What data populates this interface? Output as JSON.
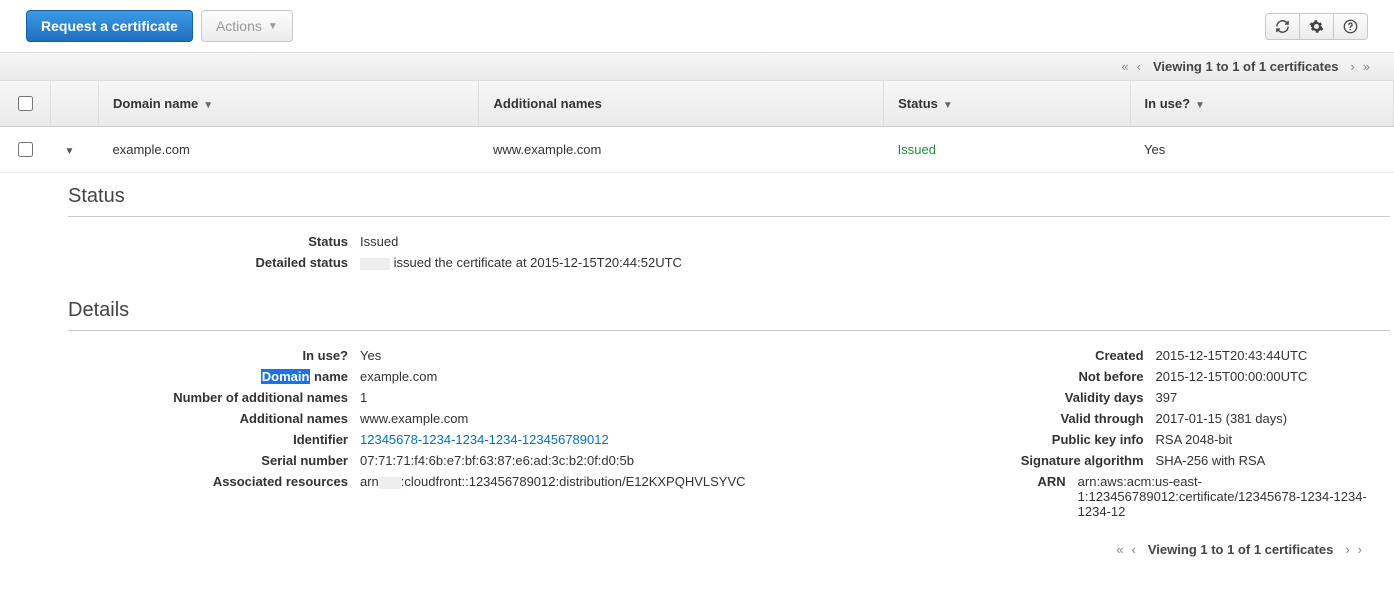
{
  "toolbar": {
    "request_label": "Request a certificate",
    "actions_label": "Actions"
  },
  "pager": {
    "text": "Viewing 1 to 1 of 1 certificates"
  },
  "table": {
    "headers": {
      "domain": "Domain name",
      "additional": "Additional names",
      "status": "Status",
      "inuse": "In use?"
    },
    "row": {
      "domain": "example.com",
      "additional": "www.example.com",
      "status": "Issued",
      "inuse": "Yes"
    }
  },
  "sections": {
    "status_title": "Status",
    "details_title": "Details"
  },
  "status": {
    "labels": {
      "status": "Status",
      "detailed": "Detailed status"
    },
    "status_value": "Issued",
    "detailed_pre": "",
    "detailed_value": " issued the certificate at 2015-12-15T20:44:52UTC"
  },
  "details": {
    "left_labels": {
      "in_use": "In use?",
      "domain_name_hi": "Domain",
      "domain_name_rest": " name",
      "num_additional": "Number of additional names",
      "additional_names": "Additional names",
      "identifier": "Identifier",
      "serial": "Serial number",
      "assoc": "Associated resources"
    },
    "left_values": {
      "in_use": "Yes",
      "domain_name": "example.com",
      "num_additional": "1",
      "additional_names": "www.example.com",
      "identifier": "12345678-1234-1234-1234-123456789012",
      "serial": "07:71:71:f4:6b:e7:bf:63:87:e6:ad:3c:b2:0f:d0:5b",
      "assoc_pre": "arn",
      "assoc_rest": ":cloudfront::123456789012:distribution/E12KXPQHVLSYVC"
    },
    "right_labels": {
      "created": "Created",
      "not_before": "Not before",
      "validity": "Validity days",
      "valid_through": "Valid through",
      "pki": "Public key info",
      "sig": "Signature algorithm",
      "arn": "ARN"
    },
    "right_values": {
      "created": "2015-12-15T20:43:44UTC",
      "not_before": "2015-12-15T00:00:00UTC",
      "validity": "397",
      "valid_through": "2017-01-15 (381 days)",
      "pki": "RSA 2048-bit",
      "sig": "SHA-256 with RSA",
      "arn": "arn:aws:acm:us-east-1:123456789012:certificate/12345678-1234-1234-1234-12"
    }
  }
}
